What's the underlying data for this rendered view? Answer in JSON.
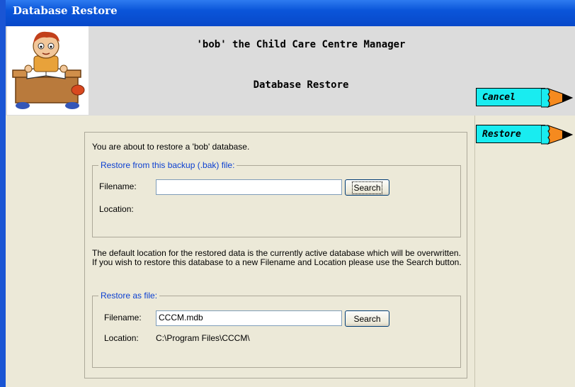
{
  "window": {
    "title": "Database Restore"
  },
  "header": {
    "app_title": "'bob' the Child Care Centre Manager",
    "screen_title": "Database Restore"
  },
  "actions": {
    "cancel_label": "Cancel",
    "restore_label": "Restore",
    "accent_color": "#19ecf0"
  },
  "intro_text": "You are about to restore a 'bob' database.",
  "backup_section": {
    "legend": "Restore from this backup (.bak) file:",
    "filename_label": "Filename:",
    "filename_value": "",
    "search_label": "Search",
    "location_label": "Location:",
    "location_value": ""
  },
  "info_text": "The default location for the restored data is the currently active database which will be overwritten.  If you wish to restore this database to a new Filename and Location please use the Search button.",
  "restore_as_section": {
    "legend": "Restore as file:",
    "filename_label": "Filename:",
    "filename_value": "CCCM.mdb",
    "search_label": "Search",
    "location_label": "Location:",
    "location_value": "C:\\Program Files\\CCCM\\"
  }
}
